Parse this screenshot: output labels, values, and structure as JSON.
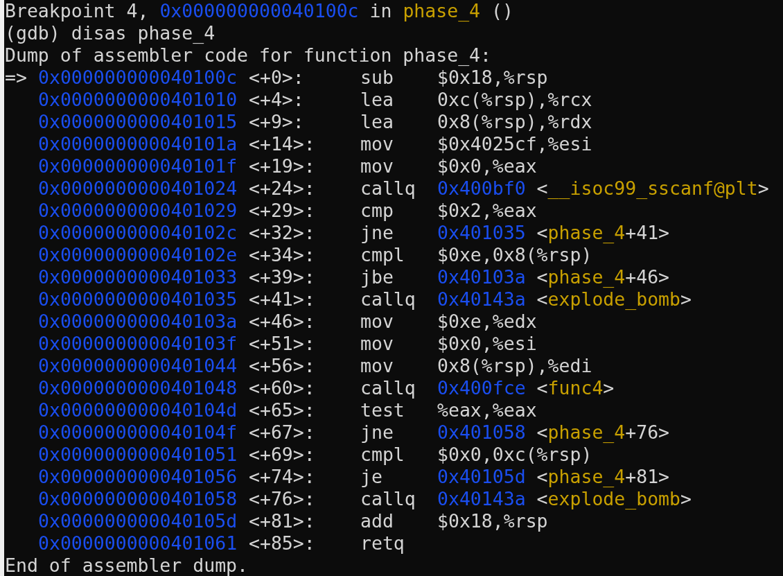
{
  "header_lines": [
    {
      "segments": [
        {
          "kind": "plain",
          "text": "Breakpoint 4, "
        },
        {
          "kind": "address",
          "text": "0x000000000040100c"
        },
        {
          "kind": "plain",
          "text": " in "
        },
        {
          "kind": "symbol",
          "text": "phase_4"
        },
        {
          "kind": "plain",
          "text": " ()"
        }
      ]
    },
    {
      "segments": [
        {
          "kind": "plain",
          "text": "(gdb) disas phase_4"
        }
      ]
    },
    {
      "segments": [
        {
          "kind": "plain",
          "text": "Dump of assembler code for function phase_4:"
        }
      ]
    }
  ],
  "current_marker": "=>",
  "instructions": [
    {
      "current": true,
      "address": "0x000000000040100c",
      "offset": "<+0>:",
      "mnemonic": "sub",
      "operands": [
        {
          "kind": "plain",
          "text": "$0x18,%rsp"
        }
      ]
    },
    {
      "current": false,
      "address": "0x0000000000401010",
      "offset": "<+4>:",
      "mnemonic": "lea",
      "operands": [
        {
          "kind": "plain",
          "text": "0xc(%rsp),%rcx"
        }
      ]
    },
    {
      "current": false,
      "address": "0x0000000000401015",
      "offset": "<+9>:",
      "mnemonic": "lea",
      "operands": [
        {
          "kind": "plain",
          "text": "0x8(%rsp),%rdx"
        }
      ]
    },
    {
      "current": false,
      "address": "0x000000000040101a",
      "offset": "<+14>:",
      "mnemonic": "mov",
      "operands": [
        {
          "kind": "plain",
          "text": "$0x4025cf,%esi"
        }
      ]
    },
    {
      "current": false,
      "address": "0x000000000040101f",
      "offset": "<+19>:",
      "mnemonic": "mov",
      "operands": [
        {
          "kind": "plain",
          "text": "$0x0,%eax"
        }
      ]
    },
    {
      "current": false,
      "address": "0x0000000000401024",
      "offset": "<+24>:",
      "mnemonic": "callq",
      "operands": [
        {
          "kind": "address",
          "text": "0x400bf0"
        },
        {
          "kind": "plain",
          "text": " <"
        },
        {
          "kind": "symbol",
          "text": "__isoc99_sscanf@plt"
        },
        {
          "kind": "plain",
          "text": ">"
        }
      ]
    },
    {
      "current": false,
      "address": "0x0000000000401029",
      "offset": "<+29>:",
      "mnemonic": "cmp",
      "operands": [
        {
          "kind": "plain",
          "text": "$0x2,%eax"
        }
      ]
    },
    {
      "current": false,
      "address": "0x000000000040102c",
      "offset": "<+32>:",
      "mnemonic": "jne",
      "operands": [
        {
          "kind": "address",
          "text": "0x401035"
        },
        {
          "kind": "plain",
          "text": " <"
        },
        {
          "kind": "symbol",
          "text": "phase_4"
        },
        {
          "kind": "plain",
          "text": "+41>"
        }
      ]
    },
    {
      "current": false,
      "address": "0x000000000040102e",
      "offset": "<+34>:",
      "mnemonic": "cmpl",
      "operands": [
        {
          "kind": "plain",
          "text": "$0xe,0x8(%rsp)"
        }
      ]
    },
    {
      "current": false,
      "address": "0x0000000000401033",
      "offset": "<+39>:",
      "mnemonic": "jbe",
      "operands": [
        {
          "kind": "address",
          "text": "0x40103a"
        },
        {
          "kind": "plain",
          "text": " <"
        },
        {
          "kind": "symbol",
          "text": "phase_4"
        },
        {
          "kind": "plain",
          "text": "+46>"
        }
      ]
    },
    {
      "current": false,
      "address": "0x0000000000401035",
      "offset": "<+41>:",
      "mnemonic": "callq",
      "operands": [
        {
          "kind": "address",
          "text": "0x40143a"
        },
        {
          "kind": "plain",
          "text": " <"
        },
        {
          "kind": "symbol",
          "text": "explode_bomb"
        },
        {
          "kind": "plain",
          "text": ">"
        }
      ]
    },
    {
      "current": false,
      "address": "0x000000000040103a",
      "offset": "<+46>:",
      "mnemonic": "mov",
      "operands": [
        {
          "kind": "plain",
          "text": "$0xe,%edx"
        }
      ]
    },
    {
      "current": false,
      "address": "0x000000000040103f",
      "offset": "<+51>:",
      "mnemonic": "mov",
      "operands": [
        {
          "kind": "plain",
          "text": "$0x0,%esi"
        }
      ]
    },
    {
      "current": false,
      "address": "0x0000000000401044",
      "offset": "<+56>:",
      "mnemonic": "mov",
      "operands": [
        {
          "kind": "plain",
          "text": "0x8(%rsp),%edi"
        }
      ]
    },
    {
      "current": false,
      "address": "0x0000000000401048",
      "offset": "<+60>:",
      "mnemonic": "callq",
      "operands": [
        {
          "kind": "address",
          "text": "0x400fce"
        },
        {
          "kind": "plain",
          "text": " <"
        },
        {
          "kind": "symbol",
          "text": "func4"
        },
        {
          "kind": "plain",
          "text": ">"
        }
      ]
    },
    {
      "current": false,
      "address": "0x000000000040104d",
      "offset": "<+65>:",
      "mnemonic": "test",
      "operands": [
        {
          "kind": "plain",
          "text": "%eax,%eax"
        }
      ]
    },
    {
      "current": false,
      "address": "0x000000000040104f",
      "offset": "<+67>:",
      "mnemonic": "jne",
      "operands": [
        {
          "kind": "address",
          "text": "0x401058"
        },
        {
          "kind": "plain",
          "text": " <"
        },
        {
          "kind": "symbol",
          "text": "phase_4"
        },
        {
          "kind": "plain",
          "text": "+76>"
        }
      ]
    },
    {
      "current": false,
      "address": "0x0000000000401051",
      "offset": "<+69>:",
      "mnemonic": "cmpl",
      "operands": [
        {
          "kind": "plain",
          "text": "$0x0,0xc(%rsp)"
        }
      ]
    },
    {
      "current": false,
      "address": "0x0000000000401056",
      "offset": "<+74>:",
      "mnemonic": "je",
      "operands": [
        {
          "kind": "address",
          "text": "0x40105d"
        },
        {
          "kind": "plain",
          "text": " <"
        },
        {
          "kind": "symbol",
          "text": "phase_4"
        },
        {
          "kind": "plain",
          "text": "+81>"
        }
      ]
    },
    {
      "current": false,
      "address": "0x0000000000401058",
      "offset": "<+76>:",
      "mnemonic": "callq",
      "operands": [
        {
          "kind": "address",
          "text": "0x40143a"
        },
        {
          "kind": "plain",
          "text": " <"
        },
        {
          "kind": "symbol",
          "text": "explode_bomb"
        },
        {
          "kind": "plain",
          "text": ">"
        }
      ]
    },
    {
      "current": false,
      "address": "0x000000000040105d",
      "offset": "<+81>:",
      "mnemonic": "add",
      "operands": [
        {
          "kind": "plain",
          "text": "$0x18,%rsp"
        }
      ]
    },
    {
      "current": false,
      "address": "0x0000000000401061",
      "offset": "<+85>:",
      "mnemonic": "retq"
    }
  ],
  "footer_lines": [
    {
      "segments": [
        {
          "kind": "plain",
          "text": "End of assembler dump."
        }
      ]
    }
  ]
}
